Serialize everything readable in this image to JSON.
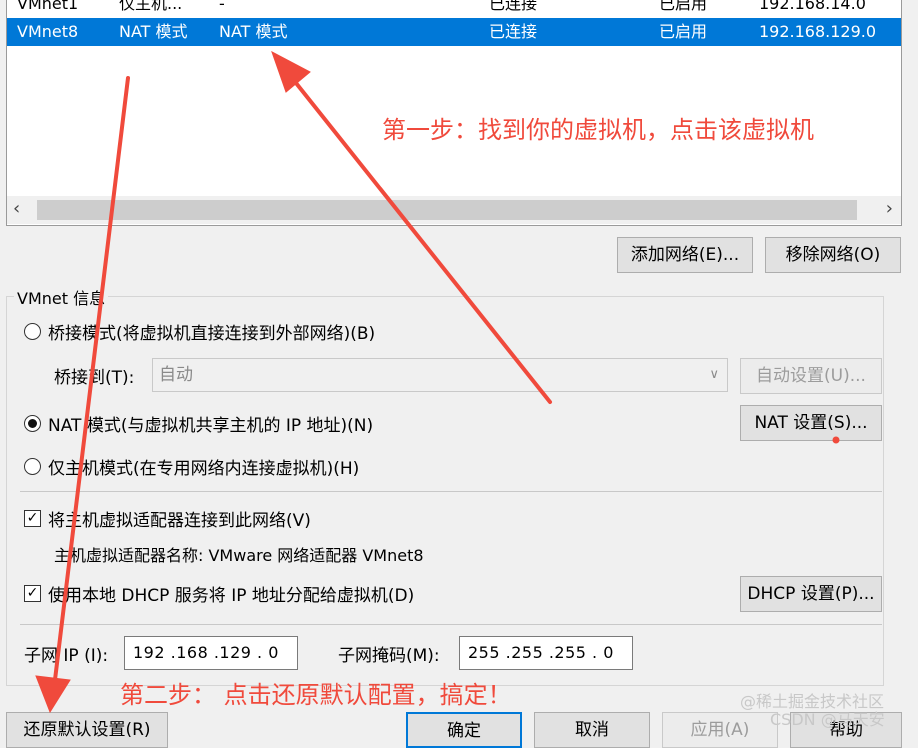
{
  "network_table": {
    "rows": [
      {
        "name": "VMnet1",
        "type": "仅主机...",
        "nat": "-",
        "host_conn": "已连接",
        "dhcp": "已启用",
        "subnet": "192.168.14.0",
        "selected": false
      },
      {
        "name": "VMnet8",
        "type": "NAT 模式",
        "nat": "NAT 模式",
        "host_conn": "已连接",
        "dhcp": "已启用",
        "subnet": "192.168.129.0",
        "selected": true
      }
    ]
  },
  "buttons": {
    "add_network": "添加网络(E)...",
    "remove_network": "移除网络(O)",
    "auto_settings": "自动设置(U)...",
    "nat_settings": "NAT 设置(S)...",
    "dhcp_settings": "DHCP 设置(P)...",
    "restore_defaults": "还原默认设置(R)",
    "ok": "确定",
    "cancel": "取消",
    "apply": "应用(A)",
    "help": "帮助"
  },
  "vmnet_info": {
    "group_title": "VMnet 信息",
    "bridged_label": "桥接模式(将虚拟机直接连接到外部网络)(B)",
    "bridge_to_label": "桥接到(T):",
    "bridge_to_value": "自动",
    "nat_label": "NAT 模式(与虚拟机共享主机的 IP 地址)(N)",
    "hostonly_label": "仅主机模式(在专用网络内连接虚拟机)(H)",
    "selected_mode": "nat",
    "connect_adapter_label": "将主机虚拟适配器连接到此网络(V)",
    "connect_adapter_checked": true,
    "adapter_name_label": "主机虚拟适配器名称: VMware 网络适配器 VMnet8",
    "dhcp_label": "使用本地 DHCP 服务将 IP 地址分配给虚拟机(D)",
    "dhcp_checked": true,
    "subnet_ip_label": "子网 IP (I):",
    "subnet_ip_value": "192 .168 .129 . 0",
    "subnet_mask_label": "子网掩码(M):",
    "subnet_mask_value": "255 .255 .255 . 0"
  },
  "annotations": {
    "step1": "第一步：找到你的虚拟机，点击该虚拟机",
    "step2": "第二步： 点击还原默认配置，搞定！",
    "color": "#f04a3c"
  },
  "watermark": {
    "line1": "@稀土掘金技术社区",
    "line2": "CSDN @马天安"
  },
  "colors": {
    "selection": "#0078d7",
    "annotation": "#f04a3c"
  }
}
